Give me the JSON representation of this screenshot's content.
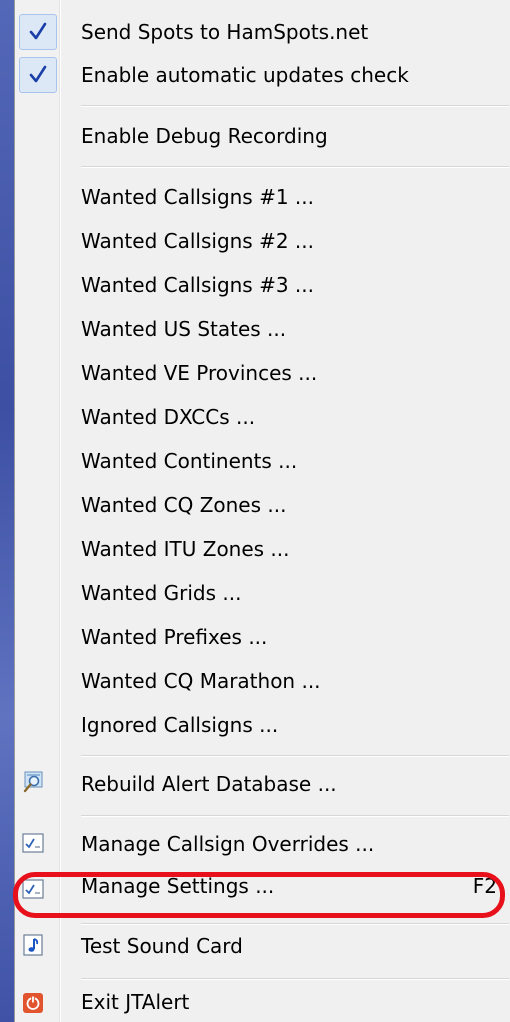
{
  "menu": {
    "checked_items": [
      {
        "label": "Send Spots to HamSpots.net",
        "checked": true
      },
      {
        "label": "Enable automatic updates check",
        "checked": true
      }
    ],
    "debug_item": {
      "label": "Enable Debug Recording"
    },
    "wanted_items": [
      {
        "label": "Wanted Callsigns #1 ..."
      },
      {
        "label": "Wanted Callsigns #2 ..."
      },
      {
        "label": "Wanted Callsigns #3 ..."
      },
      {
        "label": "Wanted US States ..."
      },
      {
        "label": "Wanted VE Provinces ..."
      },
      {
        "label": "Wanted DXCCs ..."
      },
      {
        "label": "Wanted Continents ..."
      },
      {
        "label": "Wanted CQ Zones ..."
      },
      {
        "label": "Wanted ITU Zones ..."
      },
      {
        "label": "Wanted Grids ..."
      },
      {
        "label": "Wanted Prefixes ..."
      },
      {
        "label": "Wanted CQ Marathon ..."
      },
      {
        "label": "Ignored Callsigns ..."
      }
    ],
    "rebuild_item": {
      "label": "Rebuild Alert Database ...",
      "icon": "database-search-icon"
    },
    "overrides_item": {
      "label": "Manage Callsign Overrides ...",
      "icon": "checklist-icon"
    },
    "settings_item": {
      "label": "Manage Settings ...",
      "shortcut": "F2",
      "icon": "checklist-icon"
    },
    "sound_item": {
      "label": "Test Sound Card",
      "icon": "music-note-icon"
    },
    "exit_item": {
      "label": "Exit JTAlert",
      "icon": "power-icon"
    }
  },
  "colors": {
    "highlight_annotation": "#e8101a",
    "check_mark": "#1a3fa8"
  }
}
